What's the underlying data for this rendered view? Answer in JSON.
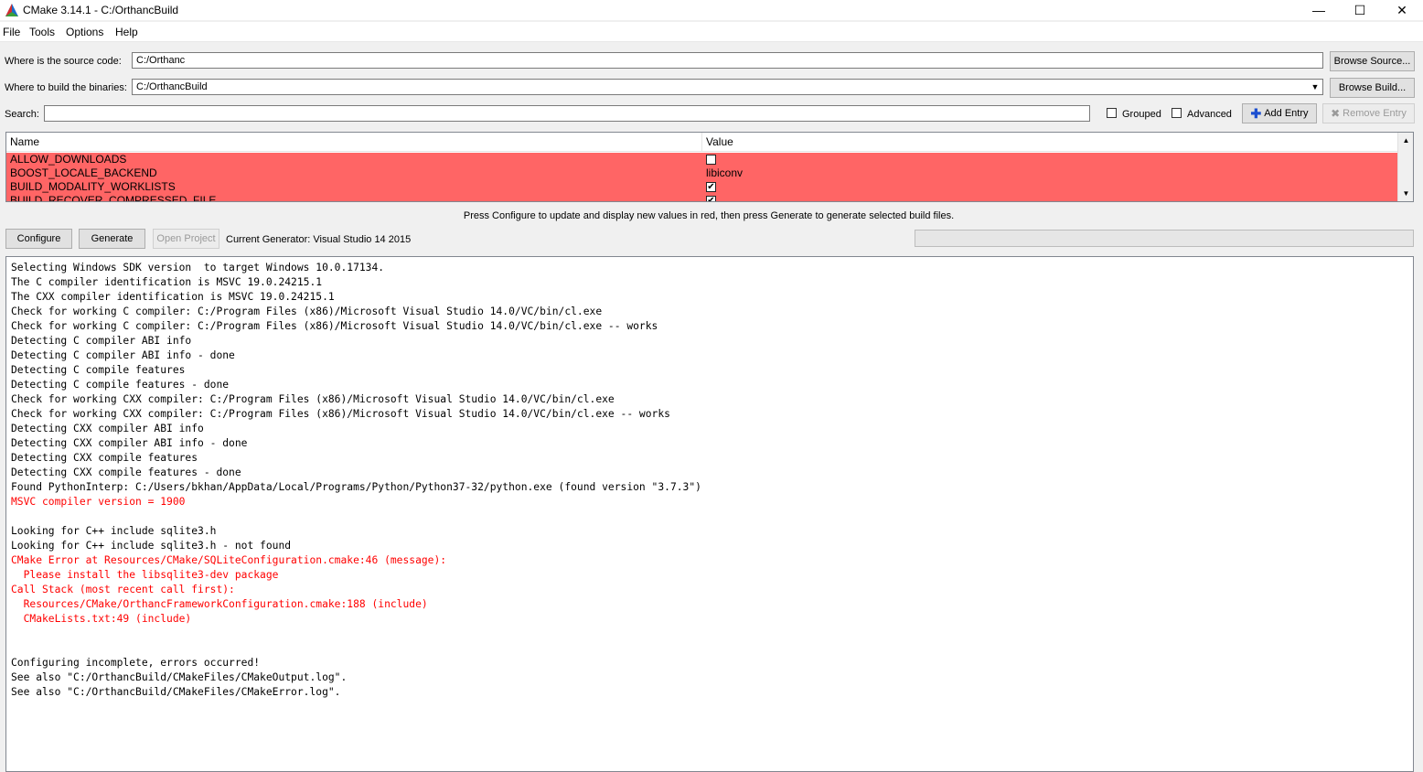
{
  "window": {
    "title": "CMake 3.14.1 - C:/OrthancBuild",
    "minimize_glyph": "—",
    "maximize_glyph": "☐",
    "close_glyph": "✕"
  },
  "menu": [
    "File",
    "Tools",
    "Options",
    "Help"
  ],
  "source": {
    "label": "Where is the source code:",
    "value": "C:/Orthanc",
    "browse_label": "Browse Source..."
  },
  "build": {
    "label": "Where to build the binaries:",
    "value": "C:/OrthancBuild",
    "browse_label": "Browse Build..."
  },
  "search": {
    "label": "Search:",
    "value": ""
  },
  "options": {
    "grouped_label": "Grouped",
    "grouped_checked": false,
    "advanced_label": "Advanced",
    "advanced_checked": false,
    "add_entry_label": "Add Entry",
    "remove_entry_label": "Remove Entry"
  },
  "table": {
    "headers": [
      "Name",
      "Value"
    ],
    "rows": [
      {
        "name": "ALLOW_DOWNLOADS",
        "type": "bool",
        "checked": false,
        "value": ""
      },
      {
        "name": "BOOST_LOCALE_BACKEND",
        "type": "text",
        "checked": false,
        "value": "libiconv"
      },
      {
        "name": "BUILD_MODALITY_WORKLISTS",
        "type": "bool",
        "checked": true,
        "value": ""
      },
      {
        "name": "BUILD_RECOVER_COMPRESSED_FILE",
        "type": "bool",
        "checked": true,
        "value": ""
      }
    ],
    "highlight_color": "#ff6565"
  },
  "hint": "Press Configure to update and display new values in red, then press Generate to generate selected build files.",
  "actions": {
    "configure_label": "Configure",
    "generate_label": "Generate",
    "open_project_label": "Open Project",
    "generator_text": "Current Generator: Visual Studio 14 2015"
  },
  "log": [
    {
      "text": "Selecting Windows SDK version  to target Windows 10.0.17134.",
      "error": false
    },
    {
      "text": "The C compiler identification is MSVC 19.0.24215.1",
      "error": false
    },
    {
      "text": "The CXX compiler identification is MSVC 19.0.24215.1",
      "error": false
    },
    {
      "text": "Check for working C compiler: C:/Program Files (x86)/Microsoft Visual Studio 14.0/VC/bin/cl.exe",
      "error": false
    },
    {
      "text": "Check for working C compiler: C:/Program Files (x86)/Microsoft Visual Studio 14.0/VC/bin/cl.exe -- works",
      "error": false
    },
    {
      "text": "Detecting C compiler ABI info",
      "error": false
    },
    {
      "text": "Detecting C compiler ABI info - done",
      "error": false
    },
    {
      "text": "Detecting C compile features",
      "error": false
    },
    {
      "text": "Detecting C compile features - done",
      "error": false
    },
    {
      "text": "Check for working CXX compiler: C:/Program Files (x86)/Microsoft Visual Studio 14.0/VC/bin/cl.exe",
      "error": false
    },
    {
      "text": "Check for working CXX compiler: C:/Program Files (x86)/Microsoft Visual Studio 14.0/VC/bin/cl.exe -- works",
      "error": false
    },
    {
      "text": "Detecting CXX compiler ABI info",
      "error": false
    },
    {
      "text": "Detecting CXX compiler ABI info - done",
      "error": false
    },
    {
      "text": "Detecting CXX compile features",
      "error": false
    },
    {
      "text": "Detecting CXX compile features - done",
      "error": false
    },
    {
      "text": "Found PythonInterp: C:/Users/bkhan/AppData/Local/Programs/Python/Python37-32/python.exe (found version \"3.7.3\")",
      "error": false
    },
    {
      "text": "MSVC compiler version = 1900",
      "error": true
    },
    {
      "text": "",
      "error": false
    },
    {
      "text": "Looking for C++ include sqlite3.h",
      "error": false
    },
    {
      "text": "Looking for C++ include sqlite3.h - not found",
      "error": false
    },
    {
      "text": "CMake Error at Resources/CMake/SQLiteConfiguration.cmake:46 (message):",
      "error": true
    },
    {
      "text": "  Please install the libsqlite3-dev package",
      "error": true
    },
    {
      "text": "Call Stack (most recent call first):",
      "error": true
    },
    {
      "text": "  Resources/CMake/OrthancFrameworkConfiguration.cmake:188 (include)",
      "error": true
    },
    {
      "text": "  CMakeLists.txt:49 (include)",
      "error": true
    },
    {
      "text": "",
      "error": false
    },
    {
      "text": "",
      "error": false
    },
    {
      "text": "Configuring incomplete, errors occurred!",
      "error": false
    },
    {
      "text": "See also \"C:/OrthancBuild/CMakeFiles/CMakeOutput.log\".",
      "error": false
    },
    {
      "text": "See also \"C:/OrthancBuild/CMakeFiles/CMakeError.log\".",
      "error": false
    }
  ],
  "colors": {
    "error_text": "#ff0000",
    "row_highlight": "#ff6565"
  },
  "icons": {
    "app": "cmake-triangle-icon",
    "add": "plus-icon",
    "remove": "x-icon"
  }
}
